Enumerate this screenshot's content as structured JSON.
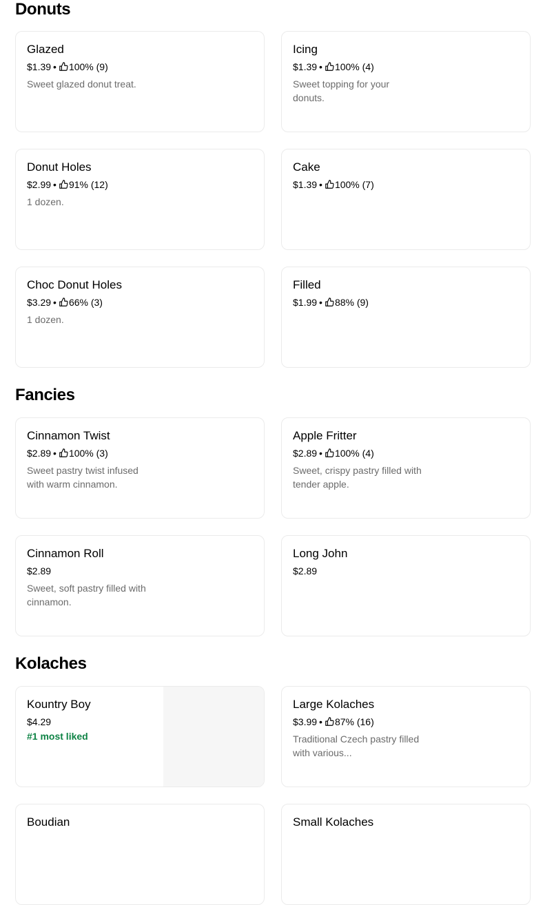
{
  "sections": [
    {
      "title": "Donuts",
      "items": [
        {
          "name": "Glazed",
          "price": "$1.39",
          "rating": "100% (9)",
          "desc": "Sweet glazed donut treat."
        },
        {
          "name": "Icing",
          "price": "$1.39",
          "rating": "100% (4)",
          "desc": "Sweet topping for your donuts."
        },
        {
          "name": "Donut Holes",
          "price": "$2.99",
          "rating": "91% (12)",
          "desc": "1 dozen."
        },
        {
          "name": "Cake",
          "price": "$1.39",
          "rating": "100% (7)"
        },
        {
          "name": "Choc Donut Holes",
          "price": "$3.29",
          "rating": "66% (3)",
          "desc": "1 dozen."
        },
        {
          "name": "Filled",
          "price": "$1.99",
          "rating": "88% (9)"
        }
      ]
    },
    {
      "title": "Fancies",
      "items": [
        {
          "name": "Cinnamon Twist",
          "price": "$2.89",
          "rating": "100% (3)",
          "desc": "Sweet pastry twist infused with warm cinnamon."
        },
        {
          "name": "Apple Fritter",
          "price": "$2.89",
          "rating": "100% (4)",
          "desc": "Sweet, crispy pastry filled with tender apple."
        },
        {
          "name": "Cinnamon Roll",
          "price": "$2.89",
          "desc": "Sweet, soft pastry filled with cinnamon."
        },
        {
          "name": "Long John",
          "price": "$2.89"
        }
      ]
    },
    {
      "title": "Kolaches",
      "items": [
        {
          "name": "Kountry Boy",
          "price": "$4.29",
          "badge": "#1 most liked"
        },
        {
          "name": "Large Kolaches",
          "price": "$3.99",
          "rating": "87% (16)",
          "desc": "Traditional Czech pastry filled with various..."
        },
        {
          "name": "Boudian"
        },
        {
          "name": "Small Kolaches"
        }
      ]
    }
  ],
  "colors": {
    "badge": "#0e8345",
    "secondary_text": "#6b6b6b",
    "card_border": "#ebebeb"
  },
  "icons": {
    "rating": "thumbs-up-icon"
  }
}
